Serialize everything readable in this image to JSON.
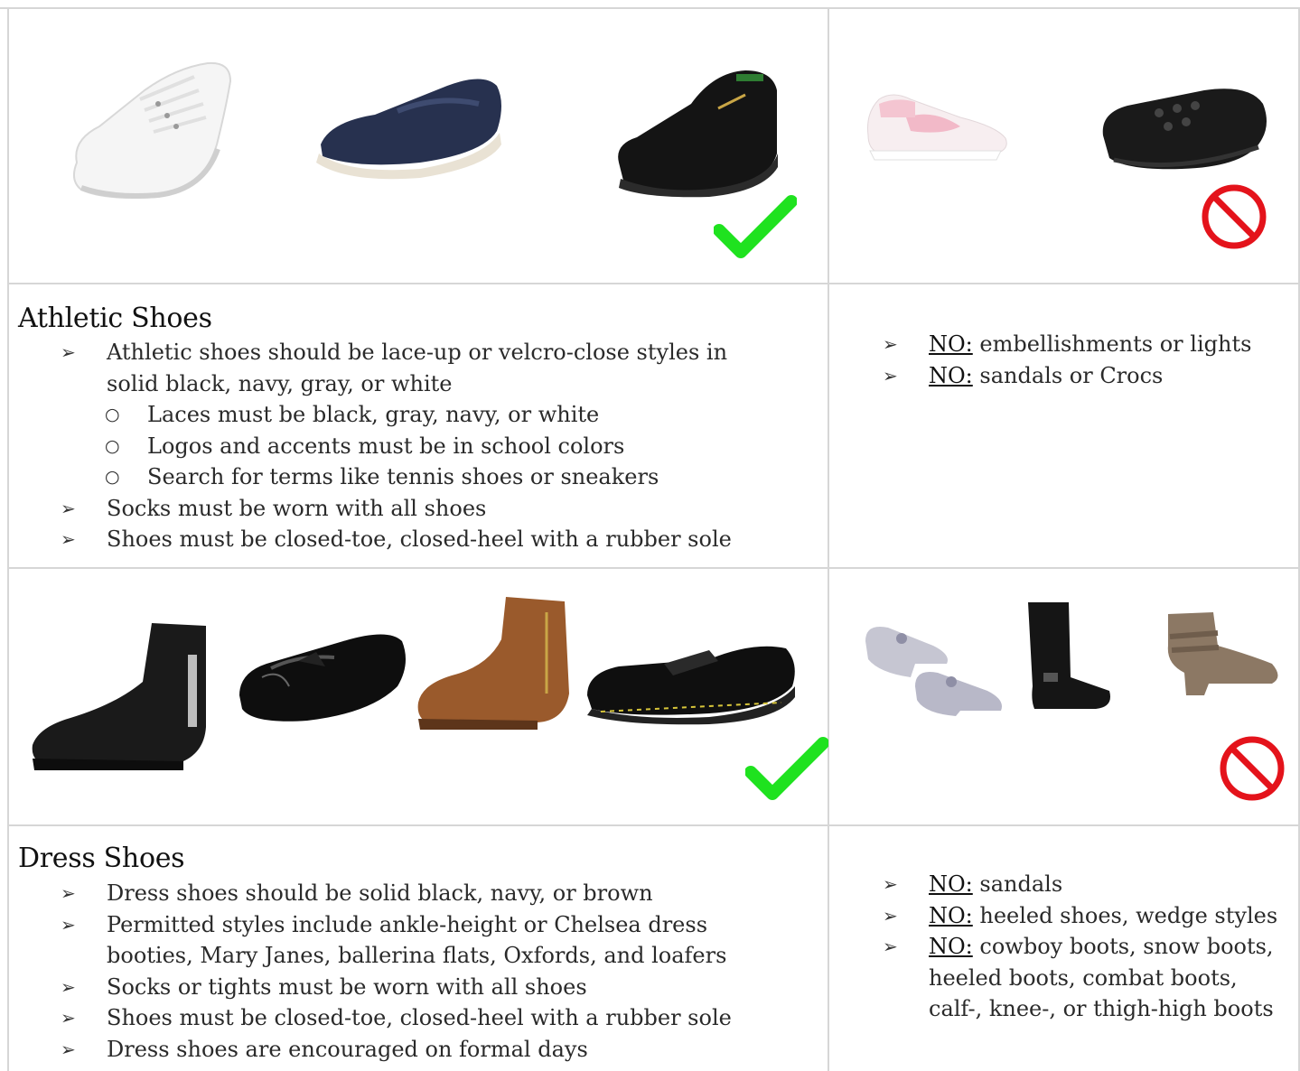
{
  "athletic": {
    "heading": "Athletic Shoes",
    "rules": [
      "Athletic shoes should be lace-up or velcro-close styles in solid black, navy, gray, or white",
      "Socks must be worn with all shoes",
      "Shoes must be closed-toe, closed-heel with a rubber sole"
    ],
    "subrules": [
      "Laces must be black, gray, navy, or white",
      "Logos and accents must be in school colors",
      "Search for terms like tennis shoes or sneakers"
    ],
    "not_allowed": [
      {
        "label": "NO:",
        "text": " embellishments or lights"
      },
      {
        "label": "NO:",
        "text": " sandals or Crocs"
      }
    ]
  },
  "dress": {
    "heading": "Dress Shoes",
    "rules": [
      "Dress shoes should be solid black, navy, or brown",
      "Permitted styles include ankle-height or Chelsea dress booties, Mary Janes, ballerina flats, Oxfords, and loafers",
      "Socks or tights must be worn with all shoes",
      "Shoes must be closed-toe, closed-heel with a rubber sole",
      "Dress shoes are encouraged on formal days"
    ],
    "not_allowed": [
      {
        "label": "NO:",
        "text": " sandals"
      },
      {
        "label": "NO:",
        "text": " heeled shoes, wedge styles"
      },
      {
        "label": "NO:",
        "text": " cowboy boots, snow boots, heeled boots, combat boots, calf-, knee-, or thigh-high boots"
      }
    ]
  },
  "icons": {
    "approved": "check-icon",
    "prohibited": "prohibited-icon",
    "approved_color": "#1fe21f",
    "prohibited_color": "#e4131b"
  },
  "images": {
    "athletic_approved": [
      "white-sneaker",
      "navy-loafer",
      "black-sneaker"
    ],
    "athletic_prohibited": [
      "pink-nike-sneaker",
      "black-crocs"
    ],
    "dress_approved": [
      "black-suede-bootie",
      "black-patent-loafer",
      "brown-ankle-boot",
      "black-mary-jane"
    ],
    "dress_prohibited": [
      "glitter-heels",
      "black-tall-boot",
      "taupe-heeled-bootie"
    ]
  }
}
